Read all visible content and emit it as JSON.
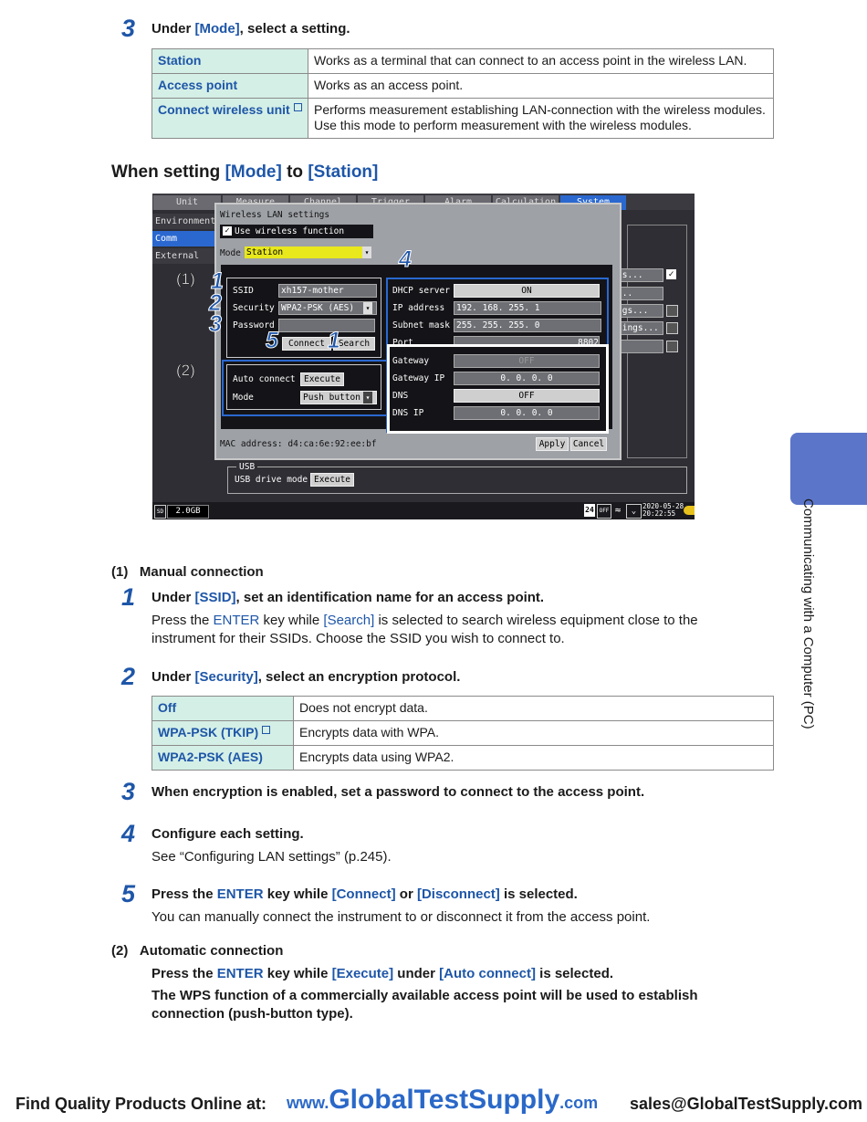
{
  "step3_top": {
    "num": "3",
    "pre": "Under ",
    "mode": "[Mode]",
    "post": ", select a setting."
  },
  "mode_table": [
    {
      "key": "Station",
      "desc": "Works as a terminal that can connect to an access point in the wireless LAN.",
      "note": false
    },
    {
      "key": "Access point",
      "desc": "Works as an access point.",
      "note": false
    },
    {
      "key": "Connect wireless unit",
      "desc": "Performs measurement establishing LAN-connection with the wireless modules.",
      "desc2": "Use this mode to perform measurement with the wireless modules.",
      "note": true
    }
  ],
  "heading": {
    "pre": "When setting ",
    "mode": "[Mode]",
    "mid": " to ",
    "station": "[Station]"
  },
  "screen": {
    "tabs": [
      "Unit",
      "Measure",
      "Channel",
      "Trigger",
      "Alarm",
      "Calculation",
      "System"
    ],
    "side_items": [
      "Environment",
      "Comm",
      "External"
    ],
    "dialog_title": "Wireless LAN settings",
    "use_wireless": "Use wireless function",
    "mode_label": "Mode",
    "mode_value": "Station",
    "ssid_label": "SSID",
    "ssid_value": "xh157-mother",
    "security_label": "Security",
    "security_value": "WPA2-PSK (AES)",
    "password_label": "Password",
    "connect_btn": "Connect",
    "search_btn": "Search",
    "auto_connect_label": "Auto connect",
    "execute_btn": "Execute",
    "mode2_label": "Mode",
    "mode2_value": "Push button",
    "dhcp_label": "DHCP server",
    "dhcp_value": "ON",
    "ip_label": "IP address",
    "ip_value": "192. 168. 255. 1",
    "subnet_label": "Subnet mask",
    "subnet_value": "255. 255. 255. 0",
    "port_label": "Port",
    "port_value": "8802",
    "gateway_label": "Gateway",
    "gateway_value": "OFF",
    "gatewayip_label": "Gateway IP",
    "gatewayip_value": "0.   0.   0.   0",
    "dns_label": "DNS",
    "dns_value": "OFF",
    "dnsip_label": "DNS IP",
    "dnsip_value": "0.   0.   0.   0",
    "mac": "MAC address: d4:ca:6e:92:ee:bf",
    "apply_btn": "Apply",
    "cancel_btn": "Cancel",
    "right_items": [
      "gs...",
      "...",
      "ngs...",
      "tings..."
    ],
    "usb_group": "USB",
    "usb_mode_label": "USB drive mode",
    "usb_execute": "Execute",
    "storage": "2.0GB",
    "status_num": "24",
    "status_off": "OFF",
    "status_date": "2020-05-28",
    "status_time": "20:22:55",
    "callouts": {
      "c1": "1",
      "c2": "2",
      "c3": "3",
      "c4": "4",
      "c5": "5",
      "c1b": "1",
      "p1": "(1)",
      "p2": "(2)"
    }
  },
  "manual": {
    "label": "(1)",
    "title": "Manual connection"
  },
  "s1": {
    "num": "1",
    "pre": "Under ",
    "k": "[SSID]",
    "post": ", set an identification name for an access point.",
    "b1": "Press the ",
    "enter": "ENTER",
    "b2": " key while ",
    "search": "[Search]",
    "b3": " is selected to search wireless equipment close to the",
    "b4": "instrument for their SSIDs. Choose the SSID you wish to connect to."
  },
  "s2": {
    "num": "2",
    "pre": "Under ",
    "k": "[Security]",
    "post": ", select an encryption protocol."
  },
  "sec_table": [
    {
      "key": "Off",
      "desc": "Does not encrypt data.",
      "note": false
    },
    {
      "key": "WPA-PSK (TKIP)",
      "desc": "Encrypts data with WPA.",
      "note": true
    },
    {
      "key": "WPA2-PSK (AES)",
      "desc": "Encrypts data using WPA2.",
      "note": false
    }
  ],
  "s3": {
    "num": "3",
    "title": "When encryption is enabled, set a password to connect to the access point."
  },
  "s4": {
    "num": "4",
    "title": "Configure each setting.",
    "body": "See “Configuring LAN settings” (p.245)."
  },
  "s5": {
    "num": "5",
    "t1": "Press the ",
    "enter": "ENTER",
    "t2": " key while ",
    "connect": "[Connect]",
    "t3": " or ",
    "disconnect": "[Disconnect]",
    "t4": " is selected.",
    "body": "You can manually connect the instrument to or disconnect it from the access point."
  },
  "auto": {
    "label": "(2)",
    "title": "Automatic connection",
    "t1": "Press the ",
    "enter": "ENTER",
    "t2": " key while ",
    "execute": "[Execute]",
    "t3": " under ",
    "autoconnect": "[Auto connect]",
    "t4": " is selected.",
    "b1": "The WPS function of a commercially available access point will be used to establish",
    "b2": "connection (push-button type)."
  },
  "side_tab_text": "Communicating with a Computer (PC)",
  "footer": {
    "left": "Find Quality Products Online at:",
    "www": "www.",
    "site": "GlobalTestSupply",
    "com": ".com",
    "email": "sales@GlobalTestSupply.com"
  },
  "colors": {
    "accent": "#1e56a8",
    "table_key_bg": "#d4efe6",
    "side_tab": "#5b75c9",
    "mode_yellow": "#e8e81c"
  }
}
